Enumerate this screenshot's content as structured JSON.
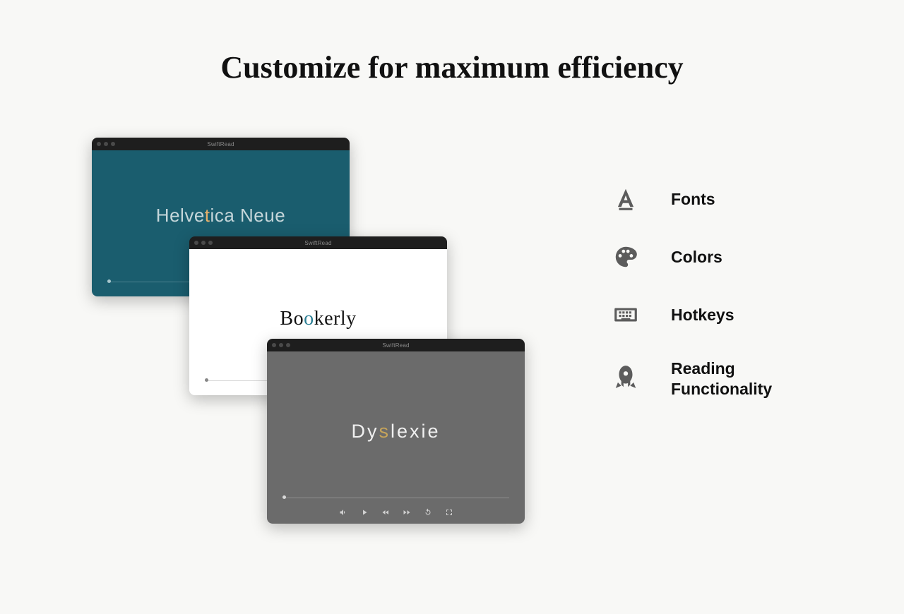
{
  "page": {
    "title": "Customize for maximum efficiency"
  },
  "app_title": "SwiftRead",
  "windows": [
    {
      "id": "helvetica",
      "font_label": "Helvetica Neue",
      "highlight_index": 5,
      "bg_color": "#1a5d6e",
      "text_color": "#c5d6da",
      "highlight_color": "#e8b06a"
    },
    {
      "id": "bookerly",
      "font_label": "Bookerly",
      "highlight_index": 2,
      "bg_color": "#ffffff",
      "text_color": "#111111",
      "highlight_color": "#2b7e94"
    },
    {
      "id": "dyslexie",
      "font_label": "Dyslexie",
      "highlight_index": 2,
      "bg_color": "#6b6b6b",
      "text_color": "#f0f0f0",
      "highlight_color": "#c7a55a"
    }
  ],
  "controls": {
    "volume": "volume-icon",
    "play": "play-icon",
    "rewind": "rewind-icon",
    "forward": "forward-icon",
    "restart": "restart-icon",
    "fullscreen": "fullscreen-icon"
  },
  "features": [
    {
      "icon": "font-icon",
      "label": "Fonts"
    },
    {
      "icon": "palette-icon",
      "label": "Colors"
    },
    {
      "icon": "keyboard-icon",
      "label": "Hotkeys"
    },
    {
      "icon": "rocket-icon",
      "label": "Reading Functionality"
    }
  ]
}
